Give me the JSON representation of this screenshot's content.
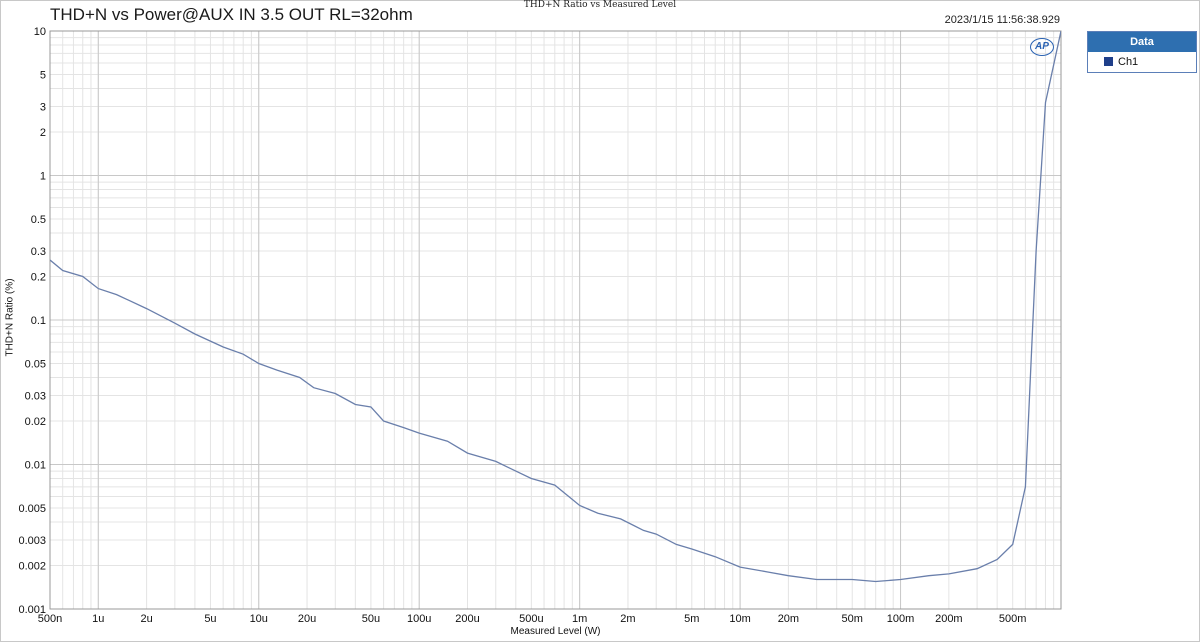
{
  "header": {
    "chart_window_title": "THD+N Ratio vs Measured Level",
    "main_title": "THD+N vs Power@AUX IN 3.5 OUT RL=32ohm",
    "timestamp": "2023/1/15 11:56:38.929",
    "logo_text": "AP"
  },
  "legend": {
    "header": "Data",
    "items": [
      {
        "label": "Ch1",
        "color": "#1f3f8a"
      }
    ]
  },
  "chart_data": {
    "type": "line",
    "title": "THD+N Ratio vs Measured Level",
    "xlabel": "Measured Level (W)",
    "ylabel": "THD+N Ratio (%)",
    "x_scale": "log",
    "y_scale": "log",
    "xlim": [
      5e-07,
      1
    ],
    "ylim": [
      0.001,
      10
    ],
    "grid": true,
    "legend_position": "right",
    "x_ticks": [
      {
        "value": 5e-07,
        "label": "500n"
      },
      {
        "value": 1e-06,
        "label": "1u"
      },
      {
        "value": 2e-06,
        "label": "2u"
      },
      {
        "value": 5e-06,
        "label": "5u"
      },
      {
        "value": 1e-05,
        "label": "10u"
      },
      {
        "value": 2e-05,
        "label": "20u"
      },
      {
        "value": 5e-05,
        "label": "50u"
      },
      {
        "value": 0.0001,
        "label": "100u"
      },
      {
        "value": 0.0002,
        "label": "200u"
      },
      {
        "value": 0.0005,
        "label": "500u"
      },
      {
        "value": 0.001,
        "label": "1m"
      },
      {
        "value": 0.002,
        "label": "2m"
      },
      {
        "value": 0.005,
        "label": "5m"
      },
      {
        "value": 0.01,
        "label": "10m"
      },
      {
        "value": 0.02,
        "label": "20m"
      },
      {
        "value": 0.05,
        "label": "50m"
      },
      {
        "value": 0.1,
        "label": "100m"
      },
      {
        "value": 0.2,
        "label": "200m"
      },
      {
        "value": 0.5,
        "label": "500m"
      }
    ],
    "y_ticks": [
      {
        "value": 10,
        "label": "10"
      },
      {
        "value": 5,
        "label": "5"
      },
      {
        "value": 3,
        "label": "3"
      },
      {
        "value": 2,
        "label": "2"
      },
      {
        "value": 1,
        "label": "1"
      },
      {
        "value": 0.5,
        "label": "0.5"
      },
      {
        "value": 0.3,
        "label": "0.3"
      },
      {
        "value": 0.2,
        "label": "0.2"
      },
      {
        "value": 0.1,
        "label": "0.1"
      },
      {
        "value": 0.05,
        "label": "0.05"
      },
      {
        "value": 0.03,
        "label": "0.03"
      },
      {
        "value": 0.02,
        "label": "0.02"
      },
      {
        "value": 0.01,
        "label": "0.01"
      },
      {
        "value": 0.005,
        "label": "0.005"
      },
      {
        "value": 0.003,
        "label": "0.003"
      },
      {
        "value": 0.002,
        "label": "0.002"
      },
      {
        "value": 0.001,
        "label": "0.001"
      }
    ],
    "series": [
      {
        "name": "Ch1",
        "color": "#6a7fab",
        "points": [
          [
            5e-07,
            0.26
          ],
          [
            6e-07,
            0.22
          ],
          [
            8e-07,
            0.2
          ],
          [
            1e-06,
            0.165
          ],
          [
            1.3e-06,
            0.15
          ],
          [
            2e-06,
            0.12
          ],
          [
            3e-06,
            0.095
          ],
          [
            4e-06,
            0.08
          ],
          [
            6e-06,
            0.065
          ],
          [
            8e-06,
            0.058
          ],
          [
            1e-05,
            0.05
          ],
          [
            1.3e-05,
            0.045
          ],
          [
            1.8e-05,
            0.04
          ],
          [
            2.2e-05,
            0.034
          ],
          [
            3e-05,
            0.031
          ],
          [
            4e-05,
            0.026
          ],
          [
            5e-05,
            0.025
          ],
          [
            6e-05,
            0.02
          ],
          [
            8e-05,
            0.018
          ],
          [
            0.0001,
            0.0165
          ],
          [
            0.00015,
            0.0145
          ],
          [
            0.0002,
            0.012
          ],
          [
            0.0003,
            0.0105
          ],
          [
            0.0004,
            0.009
          ],
          [
            0.0005,
            0.008
          ],
          [
            0.0007,
            0.0072
          ],
          [
            0.001,
            0.0052
          ],
          [
            0.0013,
            0.0046
          ],
          [
            0.0018,
            0.0042
          ],
          [
            0.0025,
            0.0035
          ],
          [
            0.003,
            0.0033
          ],
          [
            0.004,
            0.0028
          ],
          [
            0.005,
            0.0026
          ],
          [
            0.007,
            0.0023
          ],
          [
            0.01,
            0.00195
          ],
          [
            0.015,
            0.0018
          ],
          [
            0.02,
            0.0017
          ],
          [
            0.03,
            0.0016
          ],
          [
            0.05,
            0.0016
          ],
          [
            0.07,
            0.00155
          ],
          [
            0.1,
            0.0016
          ],
          [
            0.15,
            0.0017
          ],
          [
            0.2,
            0.00175
          ],
          [
            0.3,
            0.0019
          ],
          [
            0.4,
            0.0022
          ],
          [
            0.5,
            0.0028
          ],
          [
            0.6,
            0.007
          ],
          [
            0.7,
            0.3
          ],
          [
            0.8,
            3.2
          ],
          [
            1.0,
            10
          ]
        ]
      }
    ]
  }
}
